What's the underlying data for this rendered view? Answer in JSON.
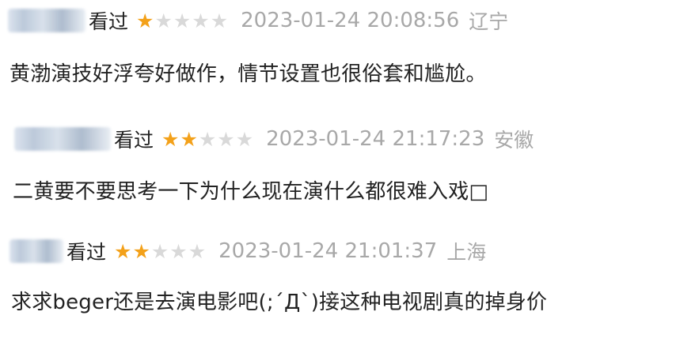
{
  "reviews": [
    {
      "status": "看过",
      "rating": 1,
      "max_rating": 5,
      "time": "2023-01-24 20:08:56",
      "location": "辽宁",
      "text": "黄渤演技好浮夸好做作，情节设置也很俗套和尴尬。"
    },
    {
      "status": "看过",
      "rating": 2,
      "max_rating": 5,
      "time": "2023-01-24 21:17:23",
      "location": "安徽",
      "text": "二黄要不要思考一下为什么现在演什么都很难入戏□"
    },
    {
      "status": "看过",
      "rating": 2,
      "max_rating": 5,
      "time": "2023-01-24 21:01:37",
      "location": "上海",
      "text": "求求beger还是去演电影吧(;´Д`)接这种电视剧真的掉身价"
    }
  ],
  "colors": {
    "star_filled": "#f3a11a",
    "star_empty": "#d9d9d9",
    "meta_text": "#a8a8a8",
    "body_text": "#222222"
  }
}
